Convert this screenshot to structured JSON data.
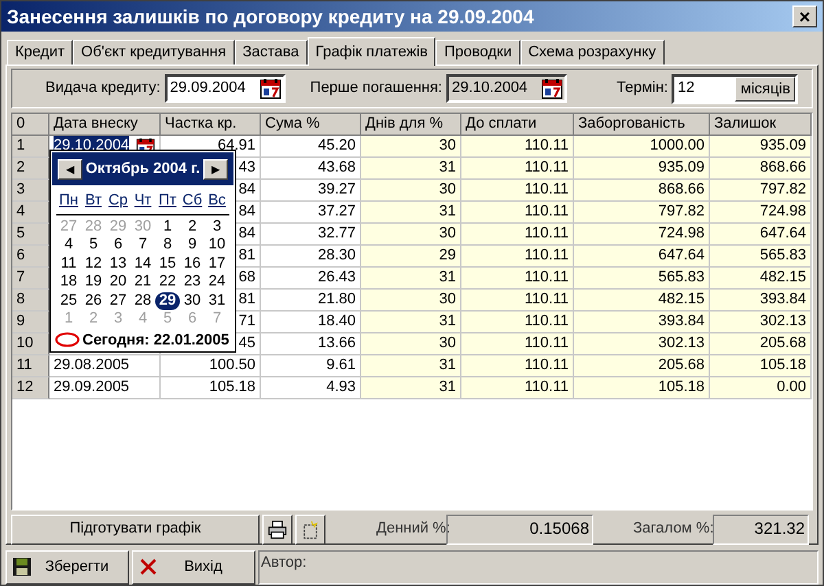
{
  "window": {
    "title": "Занесення залишків по договору кредиту на 29.09.2004",
    "close": "×"
  },
  "tabs": [
    {
      "label": "Кредит",
      "selected": false
    },
    {
      "label": "Об'єкт кредитування",
      "selected": false
    },
    {
      "label": "Застава",
      "selected": false
    },
    {
      "label": "Графік платежів",
      "selected": true
    },
    {
      "label": "Проводки",
      "selected": false
    },
    {
      "label": "Схема розрахунку",
      "selected": false
    }
  ],
  "header_fields": {
    "issue": {
      "label": "Видача кредиту:",
      "value": "29.09.2004",
      "disabled": false
    },
    "first_payment": {
      "label": "Перше погашення:",
      "value": "29.10.2004",
      "disabled": true
    },
    "term": {
      "label": "Термін:",
      "value": "12",
      "unit_button": "місяців"
    }
  },
  "table": {
    "columns": [
      "0",
      "Дата внеску",
      "Частка кр.",
      "Сума %",
      "Днів для %",
      "До сплати",
      "Заборгованість",
      "Залишок"
    ],
    "rows": [
      {
        "n": "1",
        "date": "29.10.2004",
        "part": "64.91",
        "interest": "45.20",
        "days": "30",
        "due": "110.11",
        "debt": "1000.00",
        "balance": "935.09",
        "selected": true
      },
      {
        "n": "2",
        "part": "43",
        "interest": "43.68",
        "days": "31",
        "due": "110.11",
        "debt": "935.09",
        "balance": "868.66",
        "selected": false
      },
      {
        "n": "3",
        "part": "84",
        "interest": "39.27",
        "days": "30",
        "due": "110.11",
        "debt": "868.66",
        "balance": "797.82",
        "selected": false
      },
      {
        "n": "4",
        "part": "84",
        "interest": "37.27",
        "days": "31",
        "due": "110.11",
        "debt": "797.82",
        "balance": "724.98",
        "selected": false
      },
      {
        "n": "5",
        "part": "84",
        "interest": "32.77",
        "days": "30",
        "due": "110.11",
        "debt": "724.98",
        "balance": "647.64",
        "selected": false
      },
      {
        "n": "6",
        "part": "81",
        "interest": "28.30",
        "days": "29",
        "due": "110.11",
        "debt": "647.64",
        "balance": "565.83",
        "selected": false
      },
      {
        "n": "7",
        "part": "68",
        "interest": "26.43",
        "days": "31",
        "due": "110.11",
        "debt": "565.83",
        "balance": "482.15",
        "selected": false
      },
      {
        "n": "8",
        "part": "81",
        "interest": "21.80",
        "days": "30",
        "due": "110.11",
        "debt": "482.15",
        "balance": "393.84",
        "selected": false
      },
      {
        "n": "9",
        "part": "71",
        "interest": "18.40",
        "days": "31",
        "due": "110.11",
        "debt": "393.84",
        "balance": "302.13",
        "selected": false
      },
      {
        "n": "10",
        "part": "45",
        "interest": "13.66",
        "days": "30",
        "due": "110.11",
        "debt": "302.13",
        "balance": "205.68",
        "selected": false
      },
      {
        "n": "11",
        "date": "29.08.2005",
        "part": "100.50",
        "interest": "9.61",
        "days": "31",
        "due": "110.11",
        "debt": "205.68",
        "balance": "105.18",
        "selected": false
      },
      {
        "n": "12",
        "date": "29.09.2005",
        "part": "105.18",
        "interest": "4.93",
        "days": "31",
        "due": "110.11",
        "debt": "105.18",
        "balance": "0.00",
        "selected": false
      }
    ]
  },
  "calendar": {
    "month": "Октябрь 2004 г.",
    "prev": "◀",
    "next": "▶",
    "weekdays": [
      "Пн",
      "Вт",
      "Ср",
      "Чт",
      "Пт",
      "Сб",
      "Вс"
    ],
    "weeks": [
      [
        {
          "day": "27",
          "muted": true,
          "selected": false
        },
        {
          "day": "28",
          "muted": true,
          "selected": false
        },
        {
          "day": "29",
          "muted": true,
          "selected": false
        },
        {
          "day": "30",
          "muted": true,
          "selected": false
        },
        {
          "day": "1",
          "muted": false,
          "selected": false
        },
        {
          "day": "2",
          "muted": false,
          "selected": false
        },
        {
          "day": "3",
          "muted": false,
          "selected": false
        }
      ],
      [
        {
          "day": "4",
          "muted": false,
          "selected": false
        },
        {
          "day": "5",
          "muted": false,
          "selected": false
        },
        {
          "day": "6",
          "muted": false,
          "selected": false
        },
        {
          "day": "7",
          "muted": false,
          "selected": false
        },
        {
          "day": "8",
          "muted": false,
          "selected": false
        },
        {
          "day": "9",
          "muted": false,
          "selected": false
        },
        {
          "day": "10",
          "muted": false,
          "selected": false
        }
      ],
      [
        {
          "day": "11",
          "muted": false,
          "selected": false
        },
        {
          "day": "12",
          "muted": false,
          "selected": false
        },
        {
          "day": "13",
          "muted": false,
          "selected": false
        },
        {
          "day": "14",
          "muted": false,
          "selected": false
        },
        {
          "day": "15",
          "muted": false,
          "selected": false
        },
        {
          "day": "16",
          "muted": false,
          "selected": false
        },
        {
          "day": "17",
          "muted": false,
          "selected": false
        }
      ],
      [
        {
          "day": "18",
          "muted": false,
          "selected": false
        },
        {
          "day": "19",
          "muted": false,
          "selected": false
        },
        {
          "day": "20",
          "muted": false,
          "selected": false
        },
        {
          "day": "21",
          "muted": false,
          "selected": false
        },
        {
          "day": "22",
          "muted": false,
          "selected": false
        },
        {
          "day": "23",
          "muted": false,
          "selected": false
        },
        {
          "day": "24",
          "muted": false,
          "selected": false
        }
      ],
      [
        {
          "day": "25",
          "muted": false,
          "selected": false
        },
        {
          "day": "26",
          "muted": false,
          "selected": false
        },
        {
          "day": "27",
          "muted": false,
          "selected": false
        },
        {
          "day": "28",
          "muted": false,
          "selected": false
        },
        {
          "day": "29",
          "muted": false,
          "selected": true
        },
        {
          "day": "30",
          "muted": false,
          "selected": false
        },
        {
          "day": "31",
          "muted": false,
          "selected": false
        }
      ],
      [
        {
          "day": "1",
          "muted": true,
          "selected": false
        },
        {
          "day": "2",
          "muted": true,
          "selected": false
        },
        {
          "day": "3",
          "muted": true,
          "selected": false
        },
        {
          "day": "4",
          "muted": true,
          "selected": false
        },
        {
          "day": "5",
          "muted": true,
          "selected": false
        },
        {
          "day": "6",
          "muted": true,
          "selected": false
        },
        {
          "day": "7",
          "muted": true,
          "selected": false
        }
      ]
    ],
    "today": "Сегодня: 22.01.2005"
  },
  "actions": {
    "prepare": "Підготувати графік"
  },
  "totals": {
    "daily_label": "Денний %:",
    "daily": "0.15068",
    "total_label": "Загалом %:",
    "total": "321.32"
  },
  "footer": {
    "save": "Зберегти",
    "exit": "Вихід",
    "author_label": "Автор:"
  }
}
